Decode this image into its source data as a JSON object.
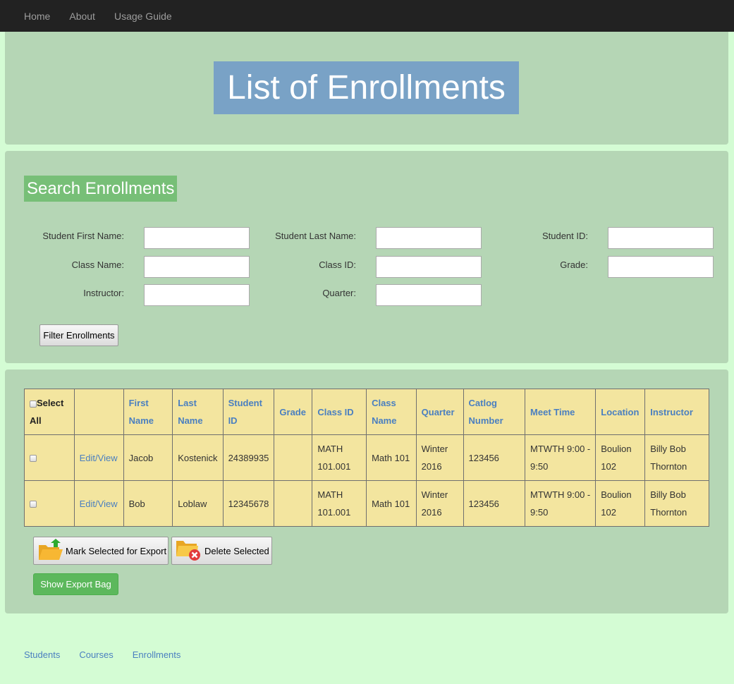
{
  "nav": {
    "items": [
      "Home",
      "About",
      "Usage Guide"
    ]
  },
  "header": {
    "title": "List of Enrollments"
  },
  "search": {
    "title": "Search Enrollments",
    "fields": {
      "first_name": {
        "label": "Student First Name:",
        "value": ""
      },
      "last_name": {
        "label": "Student Last Name:",
        "value": ""
      },
      "student_id": {
        "label": "Student ID:",
        "value": ""
      },
      "class_name": {
        "label": "Class Name:",
        "value": ""
      },
      "class_id": {
        "label": "Class ID:",
        "value": ""
      },
      "grade": {
        "label": "Grade:",
        "value": ""
      },
      "instructor": {
        "label": "Instructor:",
        "value": ""
      },
      "quarter": {
        "label": "Quarter:",
        "value": ""
      }
    },
    "filter_label": "Filter Enrollments"
  },
  "table": {
    "select_all_label": "Select All",
    "headers": [
      "First Name",
      "Last Name",
      "Student ID",
      "Grade",
      "Class ID",
      "Class Name",
      "Quarter",
      "Catlog Number",
      "Meet Time",
      "Location",
      "Instructor"
    ],
    "edit_label": "Edit/View",
    "rows": [
      {
        "first": "Jacob",
        "last": "Kostenick",
        "student_id": "24389935",
        "grade": "",
        "class_id": "MATH 101.001",
        "class_name": "Math 101",
        "quarter": "Winter 2016",
        "catalog": "123456",
        "meet_time": "MTWTH 9:00 - 9:50",
        "location": "Boulion 102",
        "instructor": "Billy Bob Thornton"
      },
      {
        "first": "Bob",
        "last": "Loblaw",
        "student_id": "12345678",
        "grade": "",
        "class_id": "MATH 101.001",
        "class_name": "Math 101",
        "quarter": "Winter 2016",
        "catalog": "123456",
        "meet_time": "MTWTH 9:00 - 9:50",
        "location": "Boulion 102",
        "instructor": "Billy Bob Thornton"
      }
    ]
  },
  "actions": {
    "mark_label": "Mark Selected for Export",
    "mark_icon": "folder-export-icon",
    "delete_label": "Delete Selected",
    "delete_icon": "folder-delete-icon",
    "export_bag_label": "Show Export Bag"
  },
  "footer": {
    "links": [
      "Students",
      "Courses",
      "Enrollments"
    ]
  },
  "colors": {
    "page_bg": "#d4fcd4",
    "panel_bg": "#b5d6b5",
    "title_bg": "#79a2c6",
    "search_title_bg": "#77bf77",
    "table_bg": "#f3e59f",
    "link": "#4a7fc0",
    "success": "#5cb85c"
  }
}
